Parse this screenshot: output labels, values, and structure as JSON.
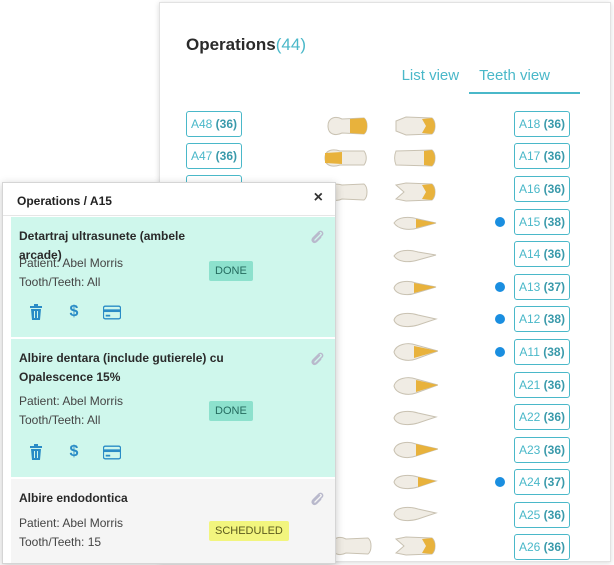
{
  "operations": {
    "title": "Operations",
    "count": "(44)",
    "tabs": [
      "List view",
      "Teeth view"
    ],
    "teeth_left": [
      {
        "label": "A48",
        "count": "(36)"
      },
      {
        "label": "A47",
        "count": "(36)"
      },
      {
        "label": "",
        "count": ""
      }
    ],
    "teeth_right": [
      {
        "label": "A18",
        "count": "(36)",
        "dot": false
      },
      {
        "label": "A17",
        "count": "(36)",
        "dot": false
      },
      {
        "label": "A16",
        "count": "(36)",
        "dot": false
      },
      {
        "label": "A15",
        "count": "(38)",
        "dot": true
      },
      {
        "label": "A14",
        "count": "(36)",
        "dot": false
      },
      {
        "label": "A13",
        "count": "(37)",
        "dot": true
      },
      {
        "label": "A12",
        "count": "(38)",
        "dot": true
      },
      {
        "label": "A11",
        "count": "(38)",
        "dot": true
      },
      {
        "label": "A21",
        "count": "(36)",
        "dot": false
      },
      {
        "label": "A22",
        "count": "(36)",
        "dot": false
      },
      {
        "label": "A23",
        "count": "(36)",
        "dot": false
      },
      {
        "label": "A24",
        "count": "(37)",
        "dot": true
      },
      {
        "label": "A25",
        "count": "(36)",
        "dot": false
      },
      {
        "label": "A26",
        "count": "(36)",
        "dot": false
      }
    ]
  },
  "panel": {
    "title": "Operations / A15",
    "close": "×",
    "items": [
      {
        "name": "Detartraj ultrasunete (ambele arcade)",
        "patient": "Patient: Abel Morris",
        "teeth": "Tooth/Teeth: All",
        "status": "DONE"
      },
      {
        "name": "Albire dentara (include gutierele) cu Opalescence 15%",
        "patient": "Patient: Abel Morris",
        "teeth": "Tooth/Teeth: All",
        "status": "DONE"
      },
      {
        "name": "Albire endodontica",
        "patient": "Patient: Abel Morris",
        "teeth": "Tooth/Teeth: 15",
        "status": "SCHEDULED"
      }
    ]
  },
  "colors": {
    "accent": "#4ab8c9",
    "done_bg": "#cff7ec",
    "dot": "#1a8ee0"
  },
  "icons": [
    "close-icon",
    "paperclip-icon",
    "trash-icon",
    "dollar-icon",
    "credit-card-icon",
    "tooth-icon"
  ]
}
